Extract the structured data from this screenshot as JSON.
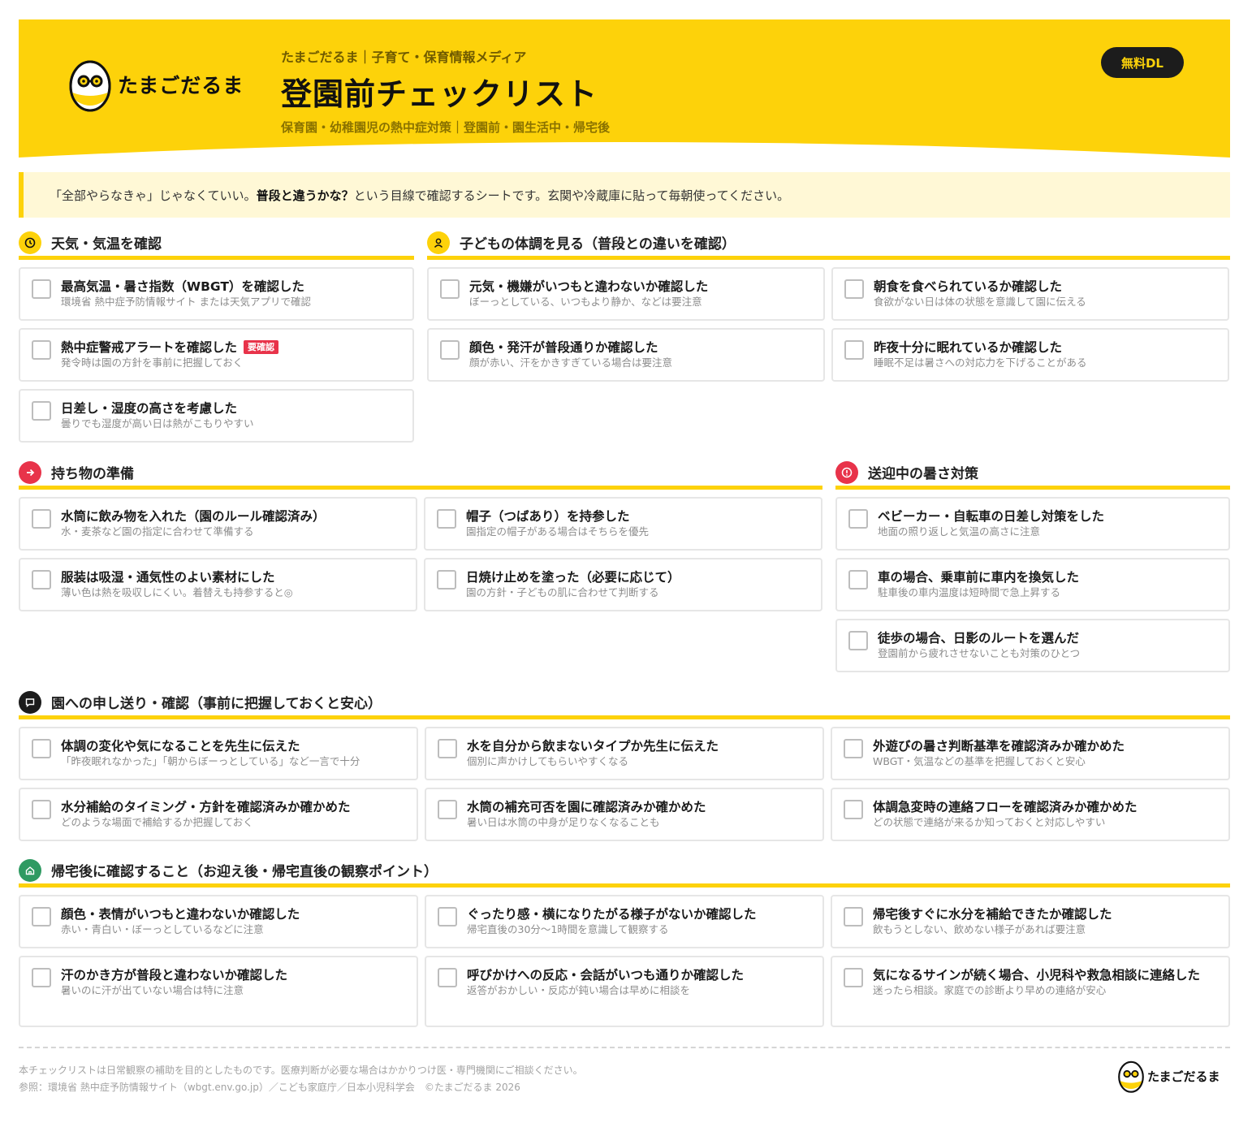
{
  "brand": {
    "name": "たまごだるま"
  },
  "header": {
    "media": "たまごだるま｜子育て・保育情報メディア",
    "title": "登園前チェックリスト",
    "subtitle": "保育園・幼稚園児の熱中症対策｜登園前・園生活中・帰宅後",
    "download_label": "無料DL"
  },
  "intro": {
    "before": "「全部やらなきゃ」じゃなくていい。",
    "bold": "普段と違うかな？",
    "after": "という目線で確認するシートです。玄関や冷蔵庫に貼って毎朝使ってください。"
  },
  "colors": {
    "accent": "#fdd20a",
    "alert": "#e8334a",
    "dark": "#1c1c1c",
    "green": "#2f9a62"
  },
  "sections": {
    "weather": {
      "title": "天気・気温を確認",
      "icon": "clock-icon",
      "items": [
        {
          "title": "最高気温・暑さ指数（WBGT）を確認した",
          "sub": "環境省 熱中症予防情報サイト または天気アプリで確認"
        },
        {
          "title": "熱中症警戒アラートを確認した",
          "badge": "要確認",
          "sub": "発令時は園の方針を事前に把握しておく"
        },
        {
          "title": "日差し・湿度の高さを考慮した",
          "sub": "曇りでも湿度が高い日は熱がこもりやすい"
        }
      ]
    },
    "condition": {
      "title": "子どもの体調を見る（普段との違いを確認）",
      "icon": "person-icon",
      "items": [
        {
          "title": "元気・機嫌がいつもと違わないか確認した",
          "sub": "ぼーっとしている、いつもより静か、などは要注意"
        },
        {
          "title": "朝食を食べられているか確認した",
          "sub": "食欲がない日は体の状態を意識して園に伝える"
        },
        {
          "title": "顔色・発汗が普段通りか確認した",
          "sub": "顔が赤い、汗をかきすぎている場合は要注意"
        },
        {
          "title": "昨夜十分に眠れているか確認した",
          "sub": "睡眠不足は暑さへの対応力を下げることがある"
        }
      ]
    },
    "belongings": {
      "title": "持ち物の準備",
      "icon": "arrow-right-icon",
      "items": [
        {
          "title": "水筒に飲み物を入れた（園のルール確認済み）",
          "sub": "水・麦茶など園の指定に合わせて準備する"
        },
        {
          "title": "帽子（つばあり）を持参した",
          "sub": "園指定の帽子がある場合はそちらを優先"
        },
        {
          "title": "服装は吸湿・通気性のよい素材にした",
          "sub": "薄い色は熱を吸収しにくい。着替えも持参すると◎"
        },
        {
          "title": "日焼け止めを塗った（必要に応じて）",
          "sub": "園の方針・子どもの肌に合わせて判断する"
        }
      ]
    },
    "commute": {
      "title": "送迎中の暑さ対策",
      "icon": "alert-icon",
      "items": [
        {
          "title": "ベビーカー・自転車の日差し対策をした",
          "sub": "地面の照り返しと気温の高さに注意"
        },
        {
          "title": "車の場合、乗車前に車内を換気した",
          "sub": "駐車後の車内温度は短時間で急上昇する"
        },
        {
          "title": "徒歩の場合、日影のルートを選んだ",
          "sub": "登園前から疲れさせないことも対策のひとつ"
        }
      ]
    },
    "handover": {
      "title": "園への申し送り・確認（事前に把握しておくと安心）",
      "icon": "speech-bubble-icon",
      "items": [
        {
          "title": "体調の変化や気になることを先生に伝えた",
          "sub": "「昨夜眠れなかった」「朝からぼーっとしている」など一言で十分"
        },
        {
          "title": "水を自分から飲まないタイプか先生に伝えた",
          "sub": "個別に声かけしてもらいやすくなる"
        },
        {
          "title": "外遊びの暑さ判断基準を確認済みか確かめた",
          "sub": "WBGT・気温などの基準を把握しておくと安心"
        },
        {
          "title": "水分補給のタイミング・方針を確認済みか確かめた",
          "sub": "どのような場面で補給するか把握しておく"
        },
        {
          "title": "水筒の補充可否を園に確認済みか確かめた",
          "sub": "暑い日は水筒の中身が足りなくなることも"
        },
        {
          "title": "体調急変時の連絡フローを確認済みか確かめた",
          "sub": "どの状態で連絡が来るか知っておくと対応しやすい"
        }
      ]
    },
    "after_home": {
      "title": "帰宅後に確認すること（お迎え後・帰宅直後の観察ポイント）",
      "icon": "home-icon",
      "items": [
        {
          "title": "顔色・表情がいつもと違わないか確認した",
          "sub": "赤い・青白い・ぼーっとしているなどに注意"
        },
        {
          "title": "ぐったり感・横になりたがる様子がないか確認した",
          "sub": "帰宅直後の30分〜1時間を意識して観察する"
        },
        {
          "title": "帰宅後すぐに水分を補給できたか確認した",
          "sub": "飲もうとしない、飲めない様子があれば要注意"
        },
        {
          "title": "汗のかき方が普段と違わないか確認した",
          "sub": "暑いのに汗が出ていない場合は特に注意"
        },
        {
          "title": "呼びかけへの反応・会話がいつも通りか確認した",
          "sub": "返答がおかしい・反応が鈍い場合は早めに相談を"
        },
        {
          "title": "気になるサインが続く場合、小児科や救急相談に連絡した",
          "sub": "迷ったら相談。家庭での診断より早めの連絡が安心"
        }
      ]
    }
  },
  "footer": {
    "note1": "本チェックリストは日常観察の補助を目的としたものです。医療判断が必要な場合はかかりつけ医・専門機関にご相談ください。",
    "note2": "参照：環境省 熱中症予防情報サイト（wbgt.env.go.jp）／こども家庭庁／日本小児科学会　©たまごだるま 2026"
  }
}
